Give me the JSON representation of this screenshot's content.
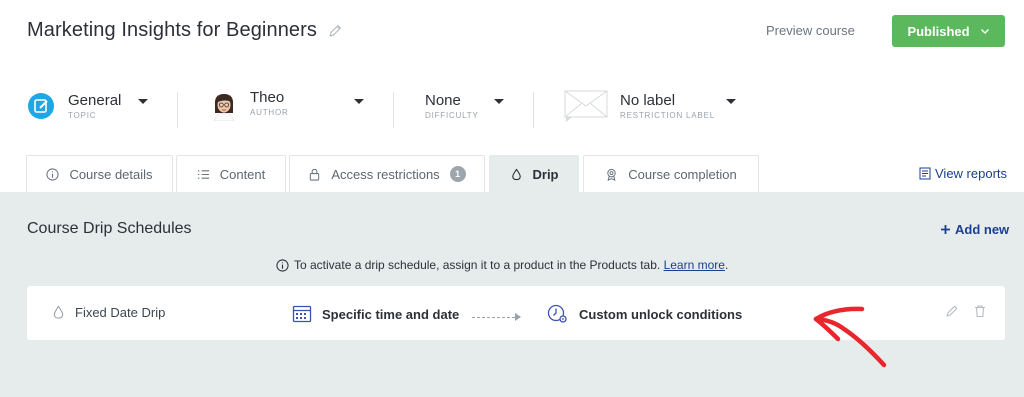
{
  "header": {
    "course_title": "Marketing Insights for Beginners",
    "preview_label": "Preview course",
    "publish_label": "Published"
  },
  "meta": {
    "topic": {
      "value": "General",
      "label": "TOPIC"
    },
    "author": {
      "value": "Theo",
      "label": "AUTHOR"
    },
    "difficulty": {
      "value": "None",
      "label": "DIFFICULTY"
    },
    "restriction": {
      "value": "No label",
      "label": "RESTRICTION LABEL"
    }
  },
  "tabs": [
    {
      "label": "Course details",
      "icon": "info-icon"
    },
    {
      "label": "Content",
      "icon": "list-icon"
    },
    {
      "label": "Access restrictions",
      "icon": "lock-icon",
      "badge": "1"
    },
    {
      "label": "Drip",
      "icon": "drop-icon",
      "active": true
    },
    {
      "label": "Course completion",
      "icon": "award-icon"
    }
  ],
  "view_reports_label": "View reports",
  "panel": {
    "title": "Course Drip Schedules",
    "add_new_label": "Add new",
    "notice_text": "To activate a drip schedule, assign it to a product in the Products tab.",
    "notice_link": "Learn more",
    "notice_end": "."
  },
  "drip_row": {
    "name": "Fixed Date Drip",
    "step_from": "Specific time and date",
    "step_to": "Custom unlock conditions"
  },
  "colors": {
    "accent_green": "#5cb85c",
    "link_blue": "#1a3f8f",
    "panel_bg": "#e6ecec",
    "annotation_red": "#e8262c"
  }
}
